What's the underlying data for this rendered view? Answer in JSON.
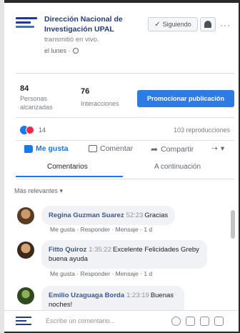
{
  "post": {
    "page_name": "Dirección Nacional de Investigación UPAL",
    "stream_label": "transmitió en vivo.",
    "time": "el lunes ·",
    "follow_label": "Siguiendo",
    "more": "···"
  },
  "stats": {
    "reached_count": "84",
    "reached_label": "Personas alcanzadas",
    "interactions_count": "76",
    "interactions_label": "Interacciones",
    "promote_label": "Promocionar publicación"
  },
  "reactions": {
    "count": "14",
    "reproductions": "103 reproducciones"
  },
  "actions": {
    "like": "Me gusta",
    "comment": "Comentar",
    "share": "Compartir",
    "more": "▾"
  },
  "tabs": {
    "comments": "Comentarios",
    "next": "A continuación"
  },
  "filter_label": "Más relevantes ▾",
  "comments": [
    {
      "name": "Regina Guzman Suarez",
      "time": "52:23",
      "text": "Gracias",
      "actions": "Me gusta · Responder · Mensaje · 1 d"
    },
    {
      "name": "Fitto Quiroz",
      "time": "1:35:22",
      "text": "Excelente Felicidades Greby buena ayuda",
      "actions": "Me gusta · Responder · Mensaje · 1 d"
    },
    {
      "name": "Emilio Uzaguaga Borda",
      "time": "1:23:19",
      "text": "Buenas noches!",
      "actions": ""
    }
  ],
  "composer": {
    "placeholder": "Escribe un comentario..."
  },
  "colors": {
    "brand": "#1877f2",
    "promote": "#2d7be5",
    "page_name": "#1f3c88",
    "love": "#f0284a"
  }
}
